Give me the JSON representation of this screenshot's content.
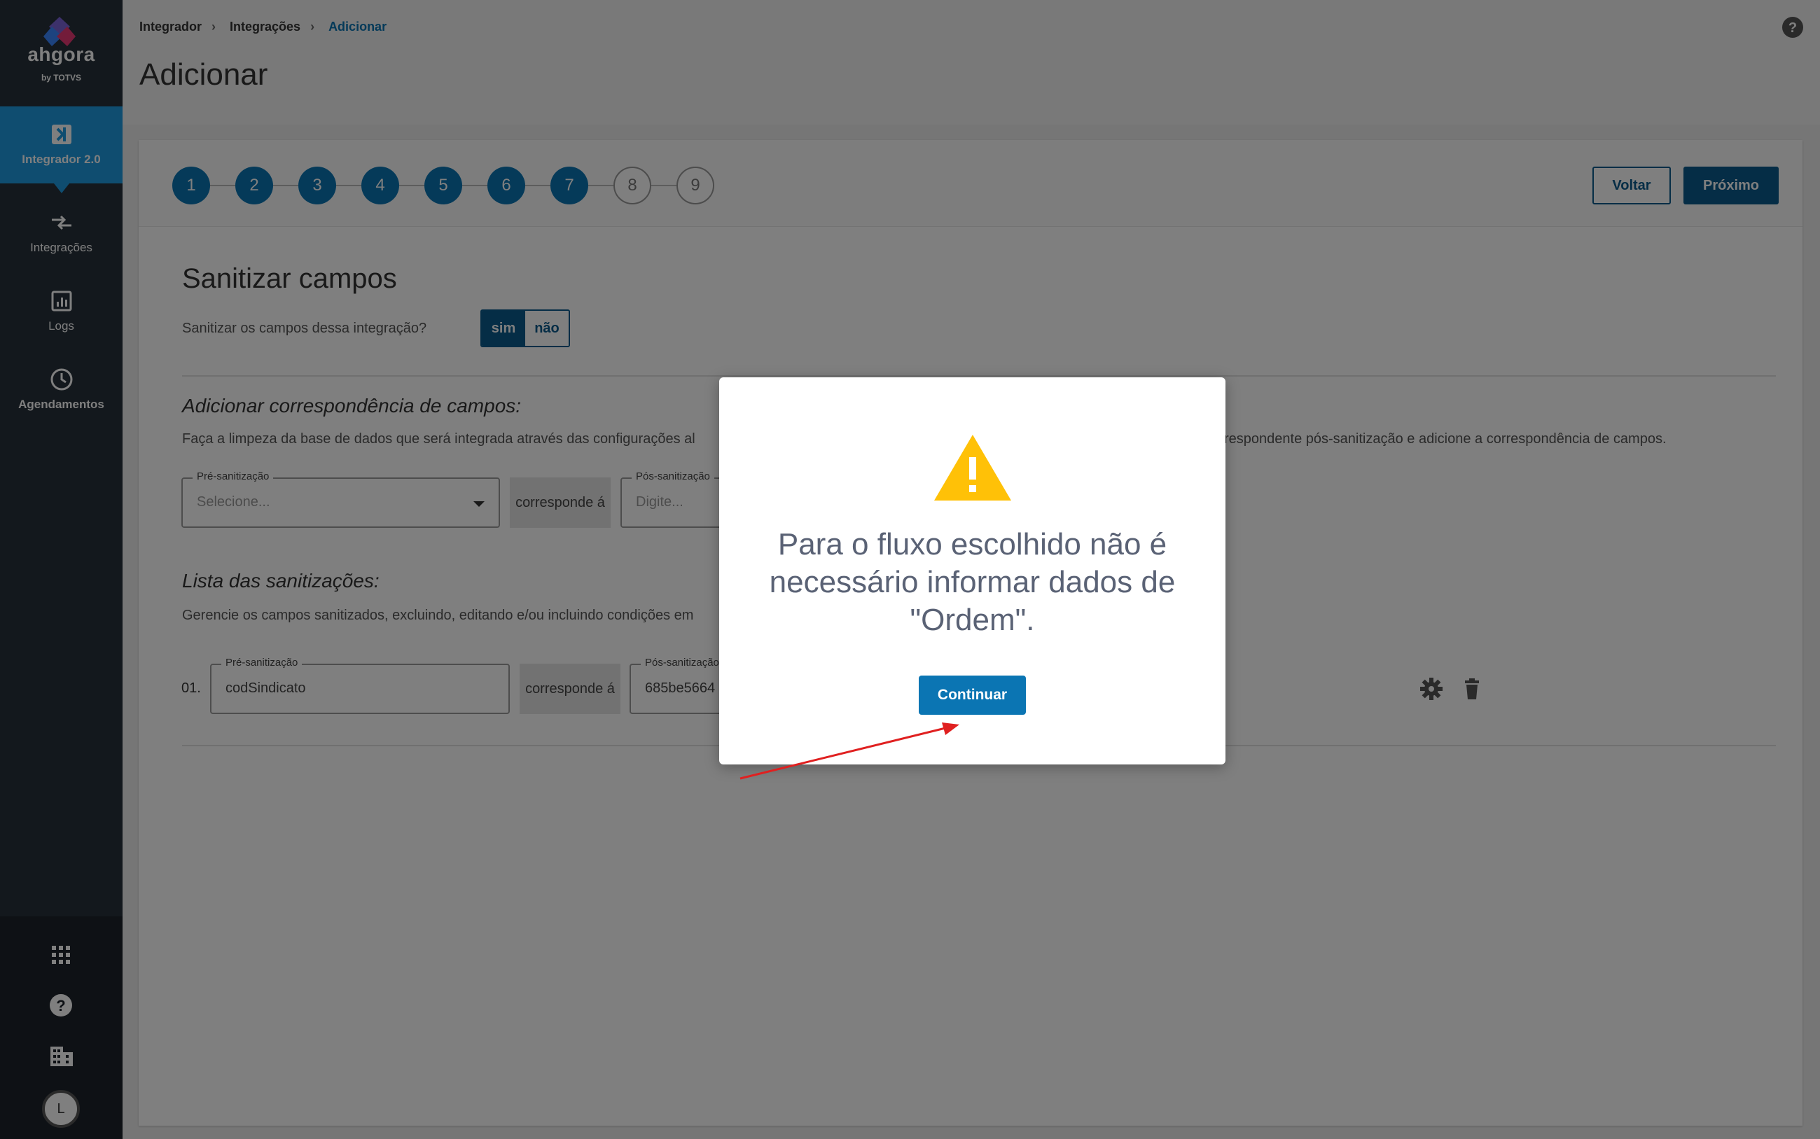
{
  "brand": {
    "name": "ahgora",
    "sub": "by TOTVS"
  },
  "sidebar": {
    "items": [
      {
        "label": "Integrador 2.0",
        "icon": "integrador-icon"
      },
      {
        "label": "Integrações",
        "icon": "swap-arrows-icon"
      },
      {
        "label": "Logs",
        "icon": "chart-icon"
      },
      {
        "label": "Agendamentos",
        "icon": "clock-icon"
      }
    ],
    "bottom_icons": [
      "apps-grid-icon",
      "help-icon",
      "building-icon",
      "avatar"
    ],
    "avatar_initial": "L"
  },
  "breadcrumb": [
    "Integrador",
    "Integrações",
    "Adicionar"
  ],
  "page_title": "Adicionar",
  "stepper": {
    "steps": [
      "1",
      "2",
      "3",
      "4",
      "5",
      "6",
      "7",
      "8",
      "9"
    ],
    "completed_count": 7,
    "back_label": "Voltar",
    "next_label": "Próximo"
  },
  "section": {
    "title": "Sanitizar campos",
    "question": "Sanitizar os campos dessa integração?",
    "toggle_yes": "sim",
    "toggle_no": "não"
  },
  "add_mapping": {
    "title": "Adicionar correspondência de campos:",
    "desc_left": "Faça a limpeza da base de dados que será integrada através das configurações al",
    "desc_right": "respondente pós-sanitização e adicione a correspondência de campos.",
    "pre_label": "Pré-sanitização",
    "pre_placeholder": "Selecione...",
    "corresponds": "corresponde á",
    "post_label": "Pós-sanitização",
    "post_placeholder": "Digite..."
  },
  "list": {
    "title": "Lista das sanitizações:",
    "desc": "Gerencie os campos sanitizados, excluindo, editando e/ou incluindo condições em",
    "rows": [
      {
        "num": "01.",
        "pre_label": "Pré-sanitização",
        "pre_value": "codSindicato",
        "corresponds": "corresponde á",
        "post_label": "Pós-sanitização",
        "post_value": "685be5664"
      }
    ]
  },
  "modal": {
    "message": "Para o fluxo escolhido não é necessário informar dados de \"Ordem\".",
    "button": "Continuar"
  },
  "colors": {
    "primary": "#0b75b3",
    "dark_primary": "#0b5a8c",
    "sidebar": "#27303a",
    "warning": "#ffc107",
    "annotation": "#e02020"
  }
}
